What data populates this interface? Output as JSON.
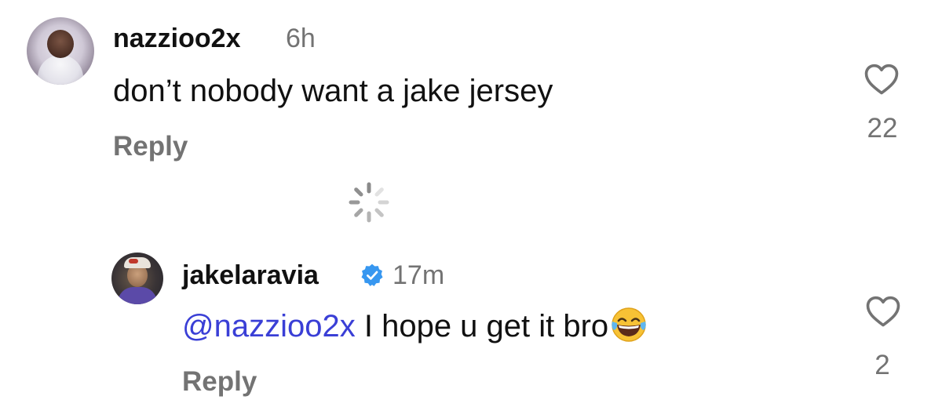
{
  "comments": [
    {
      "username": "nazzioo2x",
      "time": "6h",
      "text": "don’t nobody want a jake jersey",
      "reply_label": "Reply",
      "likes": "22",
      "avatar_icon": "profile-photo-child"
    }
  ],
  "replies": [
    {
      "username": "jakelaravia",
      "verified": true,
      "time": "17m",
      "mention": "@nazzioo2x",
      "text": " I hope u get it bro",
      "emoji": "😂",
      "reply_label": "Reply",
      "likes": "2",
      "avatar_icon": "profile-photo-man-cap"
    }
  ],
  "colors": {
    "text": "#111111",
    "secondary": "#737373",
    "mention": "#3a3fd6",
    "verified_badge": "#3797f0",
    "background": "#ffffff"
  },
  "loading": {
    "icon": "loading-spinner-icon"
  }
}
